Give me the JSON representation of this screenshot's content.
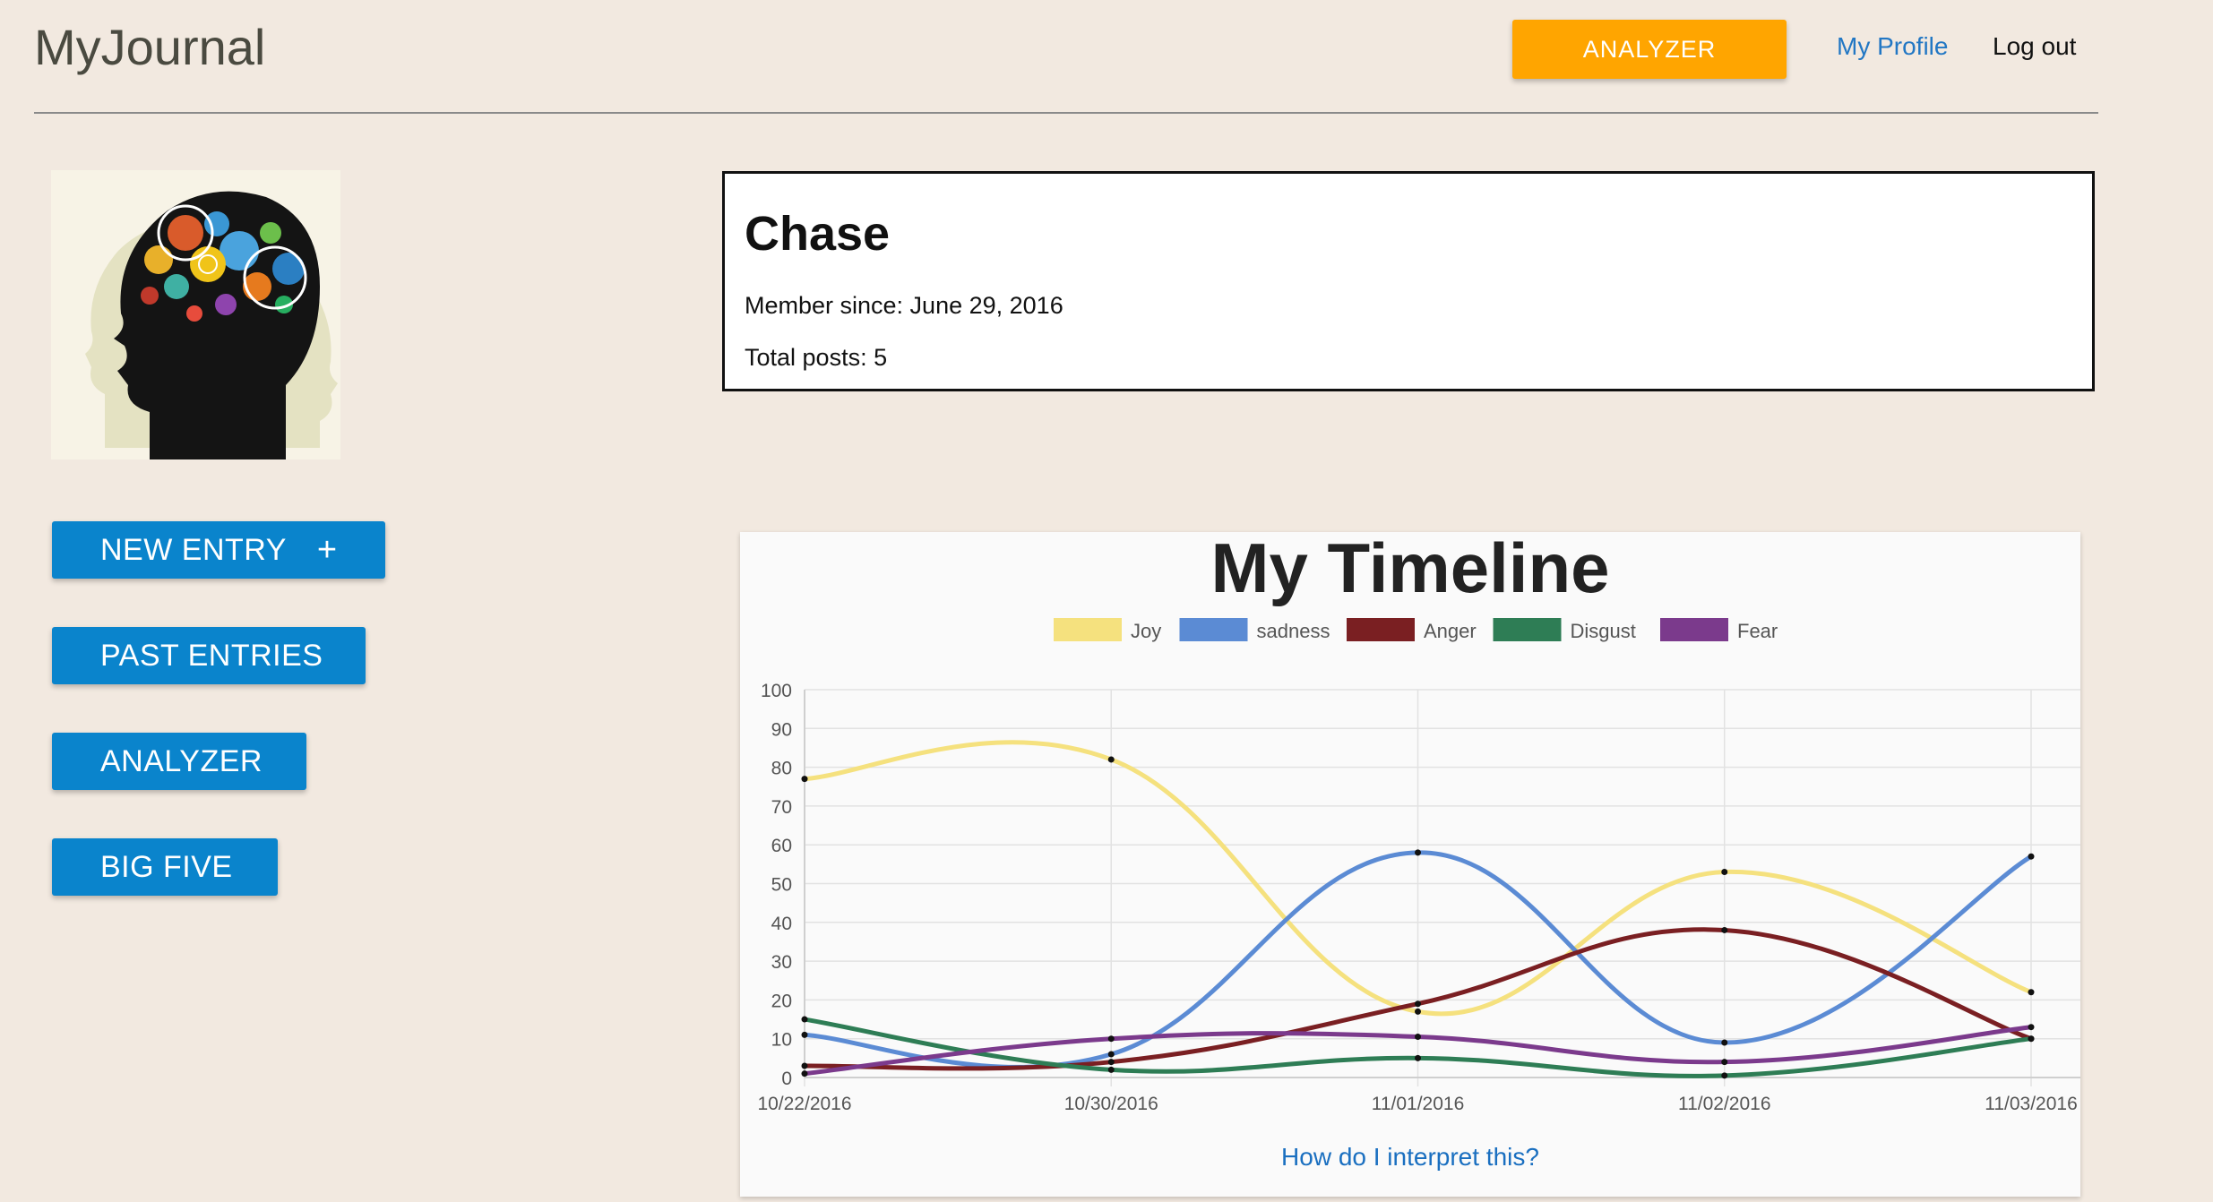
{
  "header": {
    "brand": "MyJournal",
    "analyzer_label": "ANALYZER",
    "profile_label": "My Profile",
    "logout_label": "Log out"
  },
  "sidebar": {
    "buttons": [
      {
        "label": "NEW ENTRY",
        "icon": "plus-icon",
        "glyph": "+"
      },
      {
        "label": "PAST ENTRIES"
      },
      {
        "label": "ANALYZER"
      },
      {
        "label": "BIG FIVE"
      }
    ]
  },
  "profile": {
    "name": "Chase",
    "member_since": "Member since: June 29, 2016",
    "total_posts": "Total posts: 5"
  },
  "timeline": {
    "title": "My Timeline",
    "interpret_link": "How do I interpret this?"
  },
  "colors": {
    "accent_orange": "#ffa500",
    "primary_blue": "#0a84cc",
    "link_blue": "#1a6fc0",
    "background": "#f2e9e0"
  },
  "chart_data": {
    "type": "line",
    "categories": [
      "10/22/2016",
      "10/30/2016",
      "11/01/2016",
      "11/02/2016",
      "11/03/2016"
    ],
    "ylim": [
      0,
      100
    ],
    "yticks": [
      0,
      10,
      20,
      30,
      40,
      50,
      60,
      70,
      80,
      90,
      100
    ],
    "grid": true,
    "legend_position": "top",
    "series": [
      {
        "name": "Joy",
        "color": "#f5e17e",
        "values": [
          77,
          82,
          17,
          53,
          22
        ]
      },
      {
        "name": "sadness",
        "color": "#5b8bd4",
        "values": [
          11,
          6,
          58,
          9,
          57
        ]
      },
      {
        "name": "Anger",
        "color": "#7a1f22",
        "values": [
          3,
          4,
          19,
          38,
          10
        ]
      },
      {
        "name": "Disgust",
        "color": "#2e7d55",
        "values": [
          15,
          2,
          5,
          0.5,
          10
        ]
      },
      {
        "name": "Fear",
        "color": "#7b3a8c",
        "values": [
          1,
          10,
          10.5,
          4,
          13
        ]
      }
    ]
  }
}
